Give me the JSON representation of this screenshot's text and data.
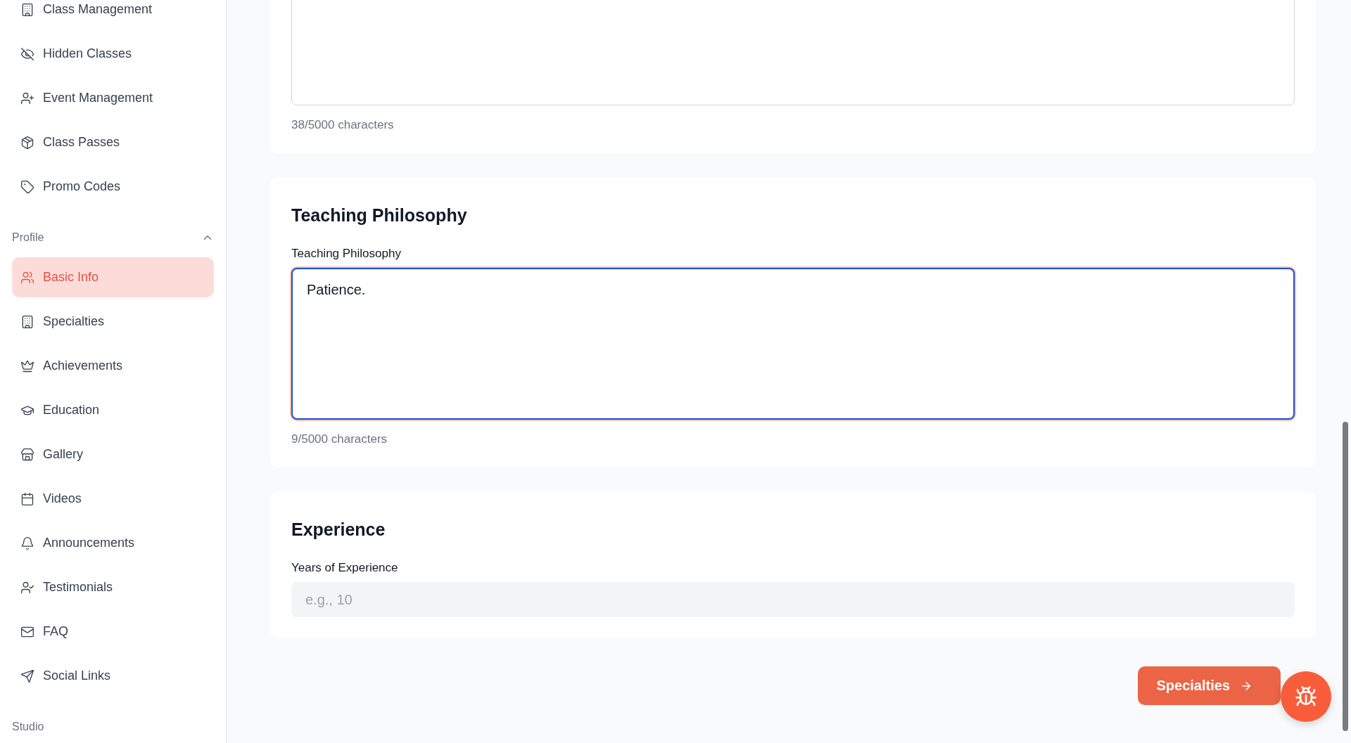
{
  "sidebar": {
    "items_top": [
      {
        "label": "Class Management",
        "selected": false
      },
      {
        "label": "Hidden Classes",
        "selected": false
      },
      {
        "label": "Event Management",
        "selected": false
      },
      {
        "label": "Class Passes",
        "selected": false
      },
      {
        "label": "Promo Codes",
        "selected": false
      }
    ],
    "profile_section": {
      "title": "Profile",
      "expanded": true,
      "items": [
        {
          "label": "Basic Info",
          "selected": true
        },
        {
          "label": "Specialties",
          "selected": false
        },
        {
          "label": "Achievements",
          "selected": false
        },
        {
          "label": "Education",
          "selected": false
        },
        {
          "label": "Gallery",
          "selected": false
        },
        {
          "label": "Videos",
          "selected": false
        },
        {
          "label": "Announcements",
          "selected": false
        },
        {
          "label": "Testimonials",
          "selected": false
        },
        {
          "label": "FAQ",
          "selected": false
        },
        {
          "label": "Social Links",
          "selected": false
        }
      ]
    },
    "studio_section": {
      "title": "Studio"
    }
  },
  "main": {
    "previous_card": {
      "counter": "38/5000 characters"
    },
    "teaching_philosophy": {
      "title": "Teaching Philosophy",
      "label": "Teaching Philosophy",
      "value": "Patience.",
      "focused": true,
      "counter": "9/5000 characters"
    },
    "experience": {
      "title": "Experience",
      "label": "Years of Experience",
      "placeholder": "e.g., 10"
    },
    "next_button": {
      "label": "Specialties"
    }
  }
}
